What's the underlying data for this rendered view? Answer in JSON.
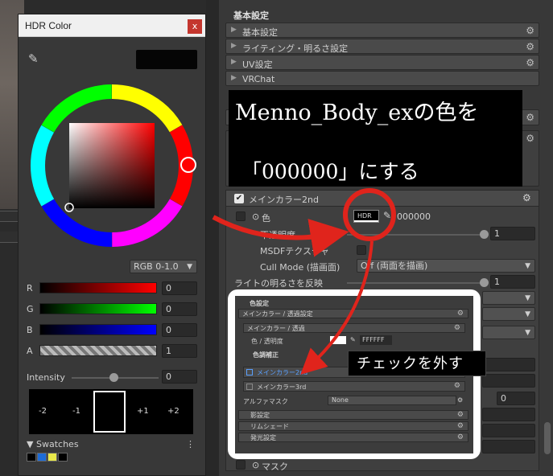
{
  "hdr_window": {
    "title": "HDR Color",
    "close_label": "x",
    "mode_select": "RGB 0-1.0",
    "channels": [
      {
        "label": "R",
        "value": "0"
      },
      {
        "label": "G",
        "value": "0"
      },
      {
        "label": "B",
        "value": "0"
      },
      {
        "label": "A",
        "value": "1"
      }
    ],
    "intensity_label": "Intensity",
    "intensity_value": "0",
    "exposure_stops": [
      "-2",
      "-1",
      "+1",
      "+2"
    ],
    "swatches_label": "Swatches",
    "swatch_colors": [
      "#000000",
      "#1e6cd6",
      "#e8e84a",
      "#000000"
    ]
  },
  "inspector": {
    "header": "基本設定",
    "foldouts": [
      "基本設定",
      "ライティング・明るさ設定",
      "UV設定",
      "VRChat"
    ],
    "main_color2": {
      "title": "メインカラー2nd",
      "color_label": "色",
      "hdr_badge": "HDR",
      "hex": "000000",
      "opacity_label": "不透明度",
      "opacity_value": "1",
      "msdf_label": "MSDFテクスチャ",
      "cull_label": "Cull Mode (描画面)",
      "cull_value": "Off (両面を描画)",
      "light_label": "ライトの明るさを反映",
      "light_value": "1",
      "mask_label": "マスク",
      "side_value": "0"
    }
  },
  "callout": {
    "line1": "Menno_Body_exの色を",
    "line2": "「000000」にする"
  },
  "inset": {
    "section": "色設定",
    "fold1": "メインカラー / 透過設定",
    "sub1": "メインカラー / 透過",
    "color_row": "色 / 透明度",
    "hex": "FFFFFF",
    "correction": "色調補正",
    "main2": "メインカラー2nd",
    "main3": "メインカラー3rd",
    "alpha_mask": "アルファマスク",
    "alpha_value": "None",
    "shadow": "影設定",
    "rim": "リムシェード",
    "emission": "発光設定"
  },
  "tooltip": "チェックを外す",
  "colors": {
    "arrow": "#e0241c",
    "accent": "#e0241c"
  }
}
